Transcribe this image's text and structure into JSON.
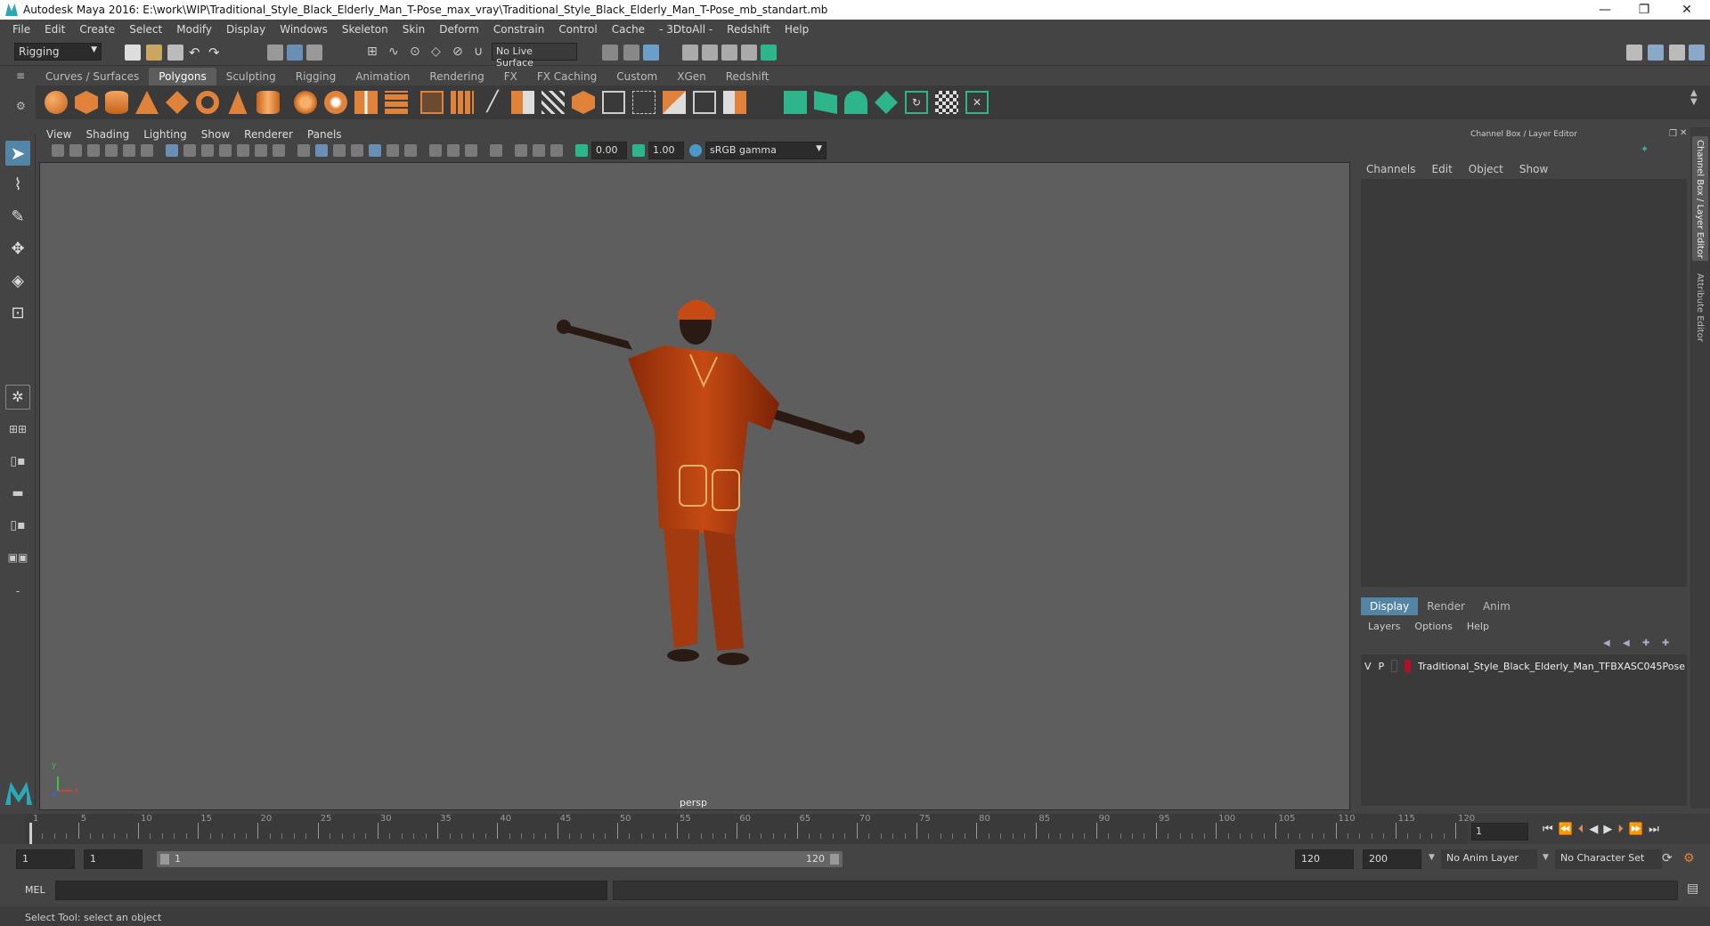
{
  "window": {
    "title": "Autodesk Maya 2016: E:\\work\\WIP\\Traditional_Style_Black_Elderly_Man_T-Pose_max_vray\\Traditional_Style_Black_Elderly_Man_T-Pose_mb_standart.mb",
    "minimize": "—",
    "restore": "❐",
    "close": "✕"
  },
  "menubar": [
    "File",
    "Edit",
    "Create",
    "Select",
    "Modify",
    "Display",
    "Windows",
    "Skeleton",
    "Skin",
    "Deform",
    "Constrain",
    "Control",
    "Cache",
    "- 3DtoAll -",
    "Redshift",
    "Help"
  ],
  "statusline": {
    "menuset": "Rigging",
    "live_surface": "No Live Surface"
  },
  "shelf_tabs": [
    "Curves / Surfaces",
    "Polygons",
    "Sculpting",
    "Rigging",
    "Animation",
    "Rendering",
    "FX",
    "FX Caching",
    "Custom",
    "XGen",
    "Redshift"
  ],
  "active_shelf_tab": "Polygons",
  "panel_menu": [
    "View",
    "Shading",
    "Lighting",
    "Show",
    "Renderer",
    "Panels"
  ],
  "panel_toolbar": {
    "exposure": "0.00",
    "gamma": "1.00",
    "color_space": "sRGB gamma"
  },
  "viewport": {
    "camera_label": "persp",
    "axis_y": "y",
    "axis_x": "x"
  },
  "channel_box": {
    "header": "Channel Box / Layer Editor",
    "menu": [
      "Channels",
      "Edit",
      "Object",
      "Show"
    ],
    "side_tab_1": "Channel Box / Layer Editor",
    "side_tab_2": "Attribute Editor"
  },
  "layer_editor": {
    "tabs": [
      "Display",
      "Render",
      "Anim"
    ],
    "active_tab": "Display",
    "menu": [
      "Layers",
      "Options",
      "Help"
    ],
    "layers": [
      {
        "v": "V",
        "p": "P",
        "color": "#b0102a",
        "name": "Traditional_Style_Black_Elderly_Man_TFBXASC045Pose"
      }
    ]
  },
  "time_slider": {
    "ticks": [
      "1",
      "5",
      "10",
      "15",
      "20",
      "25",
      "30",
      "35",
      "40",
      "45",
      "50",
      "55",
      "60",
      "65",
      "70",
      "75",
      "80",
      "85",
      "90",
      "95",
      "100",
      "105",
      "110",
      "115",
      "120"
    ],
    "current_frame": "1"
  },
  "range_slider": {
    "start": "1",
    "playback_start": "1",
    "range_start_label": "1",
    "range_end_label": "120",
    "playback_end": "120",
    "end": "200",
    "anim_layer": "No Anim Layer",
    "character_set": "No Character Set"
  },
  "command_line": {
    "language": "MEL"
  },
  "help_line": "Select Tool: select an object",
  "colors": {
    "accent": "#2aa8b8",
    "shelf_orange": "#e0823a",
    "shelf_green": "#2fb58b",
    "layer_red": "#b0102a"
  }
}
